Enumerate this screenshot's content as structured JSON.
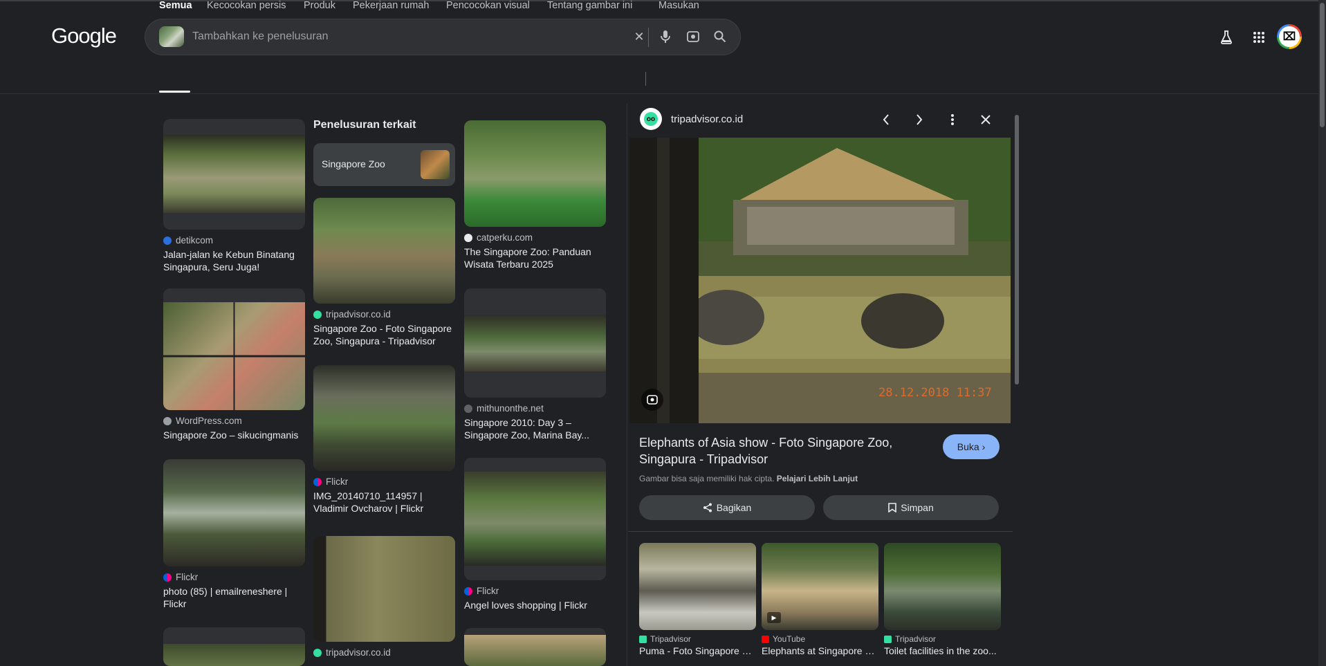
{
  "header": {
    "logo": "Google",
    "search_placeholder": "Tambahkan ke penelusuran"
  },
  "tabs": [
    "Semua",
    "Kecocokan persis",
    "Produk",
    "Pekerjaan rumah",
    "Pencocokan visual",
    "Tentang gambar ini",
    "Masukan"
  ],
  "results": {
    "col1": [
      {
        "source": "detikcom",
        "title": "Jalan-jalan ke Kebun Binatang Singapura, Seru Juga!"
      },
      {
        "source": "WordPress.com",
        "title": "Singapore Zoo – sikucingmanis"
      },
      {
        "source": "Flickr",
        "title": "photo (85) | emailreneshere | Flickr"
      }
    ],
    "col2": [
      {
        "source": "tripadvisor.co.id",
        "title": "Singapore Zoo - Foto Singapore Zoo, Singapura - Tripadvisor"
      },
      {
        "source": "Flickr",
        "title": "IMG_20140710_114957 | Vladimir Ovcharov | Flickr"
      },
      {
        "source": "tripadvisor.co.id",
        "title": ""
      }
    ],
    "col3": [
      {
        "source": "catperku.com",
        "title": "The Singapore Zoo: Panduan Wisata Terbaru 2025"
      },
      {
        "source": "mithunonthe.net",
        "title": "Singapore 2010: Day 3 – Singapore Zoo, Marina Bay..."
      },
      {
        "source": "Flickr",
        "title": "Angel loves shopping | Flickr"
      }
    ]
  },
  "related": {
    "heading": "Penelusuran terkait",
    "chip": "Singapore Zoo"
  },
  "preview": {
    "site": "tripadvisor.co.id",
    "image_timestamp": "28.12.2018  11:37",
    "title": "Elephants of Asia show - Foto Singapore Zoo, Singapura - Tripadvisor",
    "open_label": "Buka",
    "copyright_text": "Gambar bisa saja memiliki hak cipta.",
    "learn_more": "Pelajari Lebih Lanjut",
    "share_label": "Bagikan",
    "save_label": "Simpan",
    "related": [
      {
        "source": "Tripadvisor",
        "title": "Puma - Foto Singapore Zoo..."
      },
      {
        "source": "YouTube",
        "title": "Elephants at Singapore Zoo..."
      },
      {
        "source": "Tripadvisor",
        "title": "Toilet facilities in the zoo..."
      }
    ]
  },
  "colors": {
    "accent": "#8ab4f8",
    "background": "#202124",
    "surface": "#303134"
  }
}
